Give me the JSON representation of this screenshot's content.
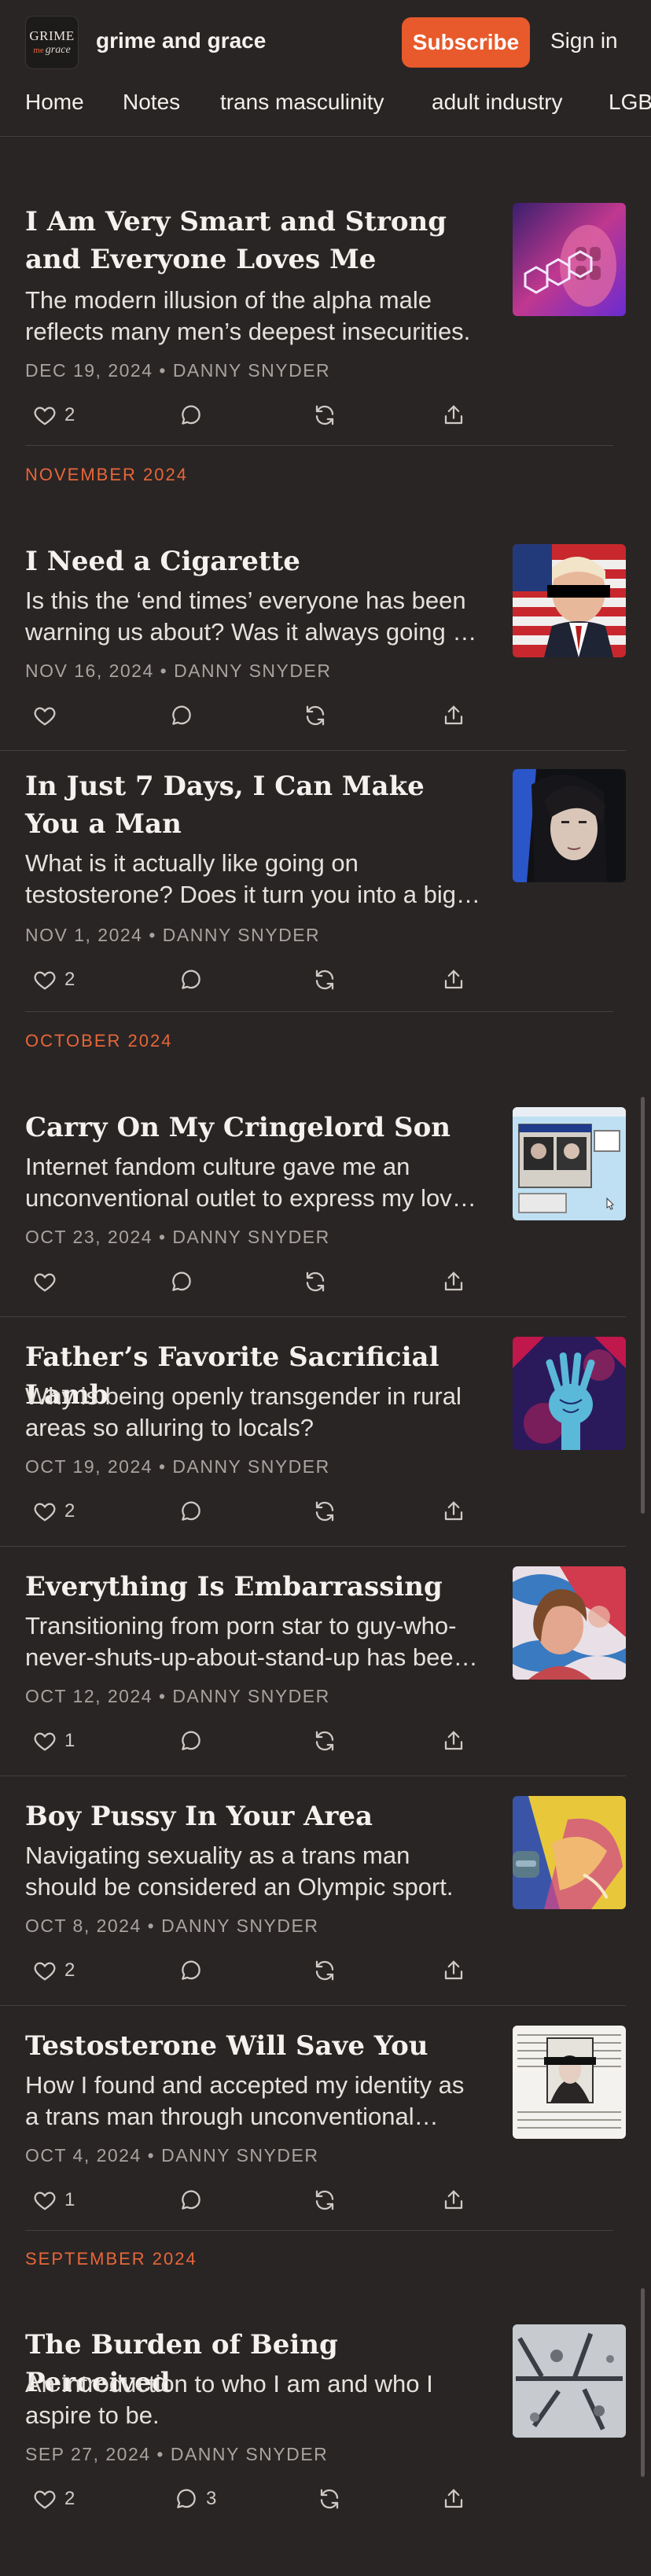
{
  "header": {
    "logo_line1": "GRIME",
    "logo_line2_prefix": "me",
    "logo_line2": "grace",
    "site_name": "grime and grace",
    "subscribe_label": "Subscribe",
    "signin_label": "Sign in"
  },
  "nav": [
    "Home",
    "Notes",
    "trans masculinity",
    "adult industry",
    "LGBT"
  ],
  "months": [
    "NOVEMBER 2024",
    "OCTOBER 2024",
    "SEPTEMBER 2024"
  ],
  "posts": [
    {
      "title": "I Am Very Smart and Strong and Everyone Loves Me",
      "subtitle": "The modern illusion of the alpha male reflects many men’s deepest insecurities.",
      "meta": "DEC 19, 2024 • DANNY SNYDER",
      "likes": "2",
      "comments": ""
    },
    {
      "title": "I Need a Cigarette",
      "subtitle": "Is this the ‘end times’ everyone has been warning us about? Was it always going to be like this?",
      "meta": "NOV 16, 2024 • DANNY SNYDER",
      "likes": "",
      "comments": ""
    },
    {
      "title": "In Just 7 Days, I Can Make You a Man",
      "subtitle": "What is it actually like going on testosterone? Does it turn you into a big hairy monster?",
      "meta": "NOV 1, 2024 • DANNY SNYDER",
      "likes": "2",
      "comments": ""
    },
    {
      "title": "Carry On My Cringelord Son",
      "subtitle": "Internet fandom culture gave me an unconventional outlet to express my love of writing.",
      "meta": "OCT 23, 2024 • DANNY SNYDER",
      "likes": "",
      "comments": ""
    },
    {
      "title": "Father’s Favorite Sacrificial Lamb",
      "subtitle": "Why is being openly transgender in rural areas so alluring to locals?",
      "meta": "OCT 19, 2024 • DANNY SNYDER",
      "likes": "2",
      "comments": ""
    },
    {
      "title": "Everything Is Embarrassing",
      "subtitle": "Transitioning from porn star to guy-who-never-shuts-up-about-stand-up has been a journey.",
      "meta": "OCT 12, 2024 • DANNY SNYDER",
      "likes": "1",
      "comments": ""
    },
    {
      "title": "Boy Pussy In Your Area",
      "subtitle": "Navigating sexuality as a trans man should be considered an Olympic sport.",
      "meta": "OCT 8, 2024 • DANNY SNYDER",
      "likes": "2",
      "comments": ""
    },
    {
      "title": "Testosterone Will Save You",
      "subtitle": "How I found and accepted my identity as a trans man through unconventional means.",
      "meta": "OCT 4, 2024 • DANNY SNYDER",
      "likes": "1",
      "comments": ""
    },
    {
      "title": "The Burden of Being Perceived",
      "subtitle": "An introduction to who I am and who I aspire to be.",
      "meta": "SEP 27, 2024 • DANNY SNYDER",
      "likes": "2",
      "comments": "3"
    }
  ],
  "icons": {
    "like": "heart-icon",
    "comment": "comment-icon",
    "restack": "restack-icon",
    "share": "share-icon"
  },
  "colors": {
    "background": "#292524",
    "accent": "#e8592b",
    "month_label": "#e8663a"
  }
}
